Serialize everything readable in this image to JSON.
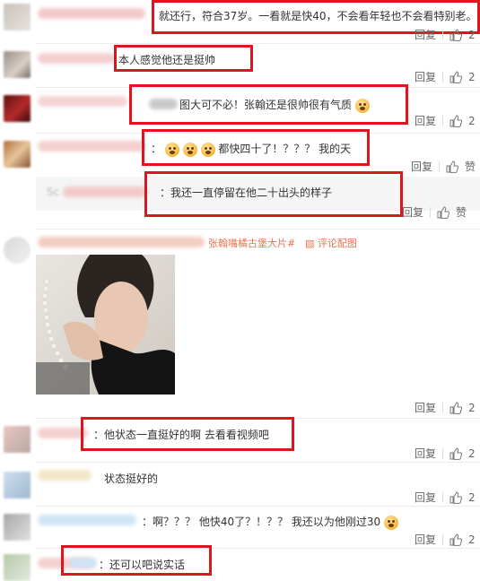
{
  "labels": {
    "reply": "回复",
    "like": "赞"
  },
  "comments": [
    {
      "text": "就还行，符合37岁。一看就是快40，不会看年轻也不会看特别老。",
      "likes": "2"
    },
    {
      "text": "本人感觉他还是挺帅",
      "likes": "2"
    },
    {
      "text": "图大可不必！张翰还是很帅很有气质",
      "likes": "2"
    },
    {
      "text": "：",
      "text2": "都快四十了！？？？ 我的天",
      "likes": "赞"
    },
    {
      "text": "：我还一直停留在他二十出头的样子",
      "likes": "赞",
      "quoted_prefix": "Sc"
    },
    {
      "hashtag": "张翰嘴橘古堡大片#",
      "pic_label": "评论配图",
      "likes": "2"
    },
    {
      "text": "：他状态一直挺好的啊 去看看视频吧",
      "likes": "2"
    },
    {
      "text": "状态挺好的",
      "likes": "2"
    },
    {
      "text": "：啊？？？ 他快40了？！？？ 我还以为他刚过30",
      "likes": "2"
    },
    {
      "text": "：还可以吧说实话",
      "likes": ""
    }
  ],
  "colors": {
    "highlight": "#e0141e",
    "link": "#eb7350"
  }
}
